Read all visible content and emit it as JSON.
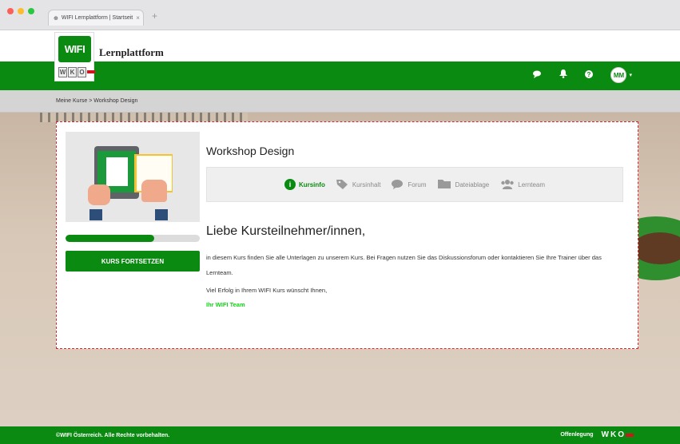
{
  "browser": {
    "tab_title": "WIFI Lernplattform | Startseit",
    "tab_close": "×",
    "new_tab": "+"
  },
  "header": {
    "logo_text": "WIFI",
    "logo_sub": [
      "W",
      "K",
      "O"
    ],
    "brand": "Lernplattform",
    "avatar_initials": "MM",
    "avatar_caret": "▾"
  },
  "breadcrumb": "Meine Kurse > Workshop Design",
  "course": {
    "title": "Workshop Design",
    "progress_fraction": 0.66,
    "cta_label": "KURS FORTSETZEN"
  },
  "nav": {
    "items": [
      {
        "label": "Kursinfo",
        "icon": "info-icon",
        "active": true
      },
      {
        "label": "Kursinhalt",
        "icon": "tag-icon",
        "active": false
      },
      {
        "label": "Forum",
        "icon": "chat-icon",
        "active": false
      },
      {
        "label": "Dateiablage",
        "icon": "folder-icon",
        "active": false
      },
      {
        "label": "Lernteam",
        "icon": "team-icon",
        "active": false
      }
    ]
  },
  "content": {
    "heading": "Liebe Kursteilnehmer/innen,",
    "paragraph": "in diesem Kurs finden Sie alle Unterlagen zu unserem Kurs. Bei Fragen nutzen Sie das Diskussionsforum oder kontaktieren Sie Ihre Trainer über das Lernteam.",
    "closing": "Viel Erfolg in Ihrem WIFI Kurs wünscht Ihnen,",
    "signature": "Ihr WIFI Team"
  },
  "footer": {
    "copyright": "©WIFI Österreich. Alle Rechte vorbehalten.",
    "link": "Offenlegung",
    "wko": [
      "W",
      "K",
      "O"
    ]
  },
  "colors": {
    "brand_green": "#0b8a12",
    "signature_green": "#0fd316",
    "wko_red": "#d2141c"
  }
}
